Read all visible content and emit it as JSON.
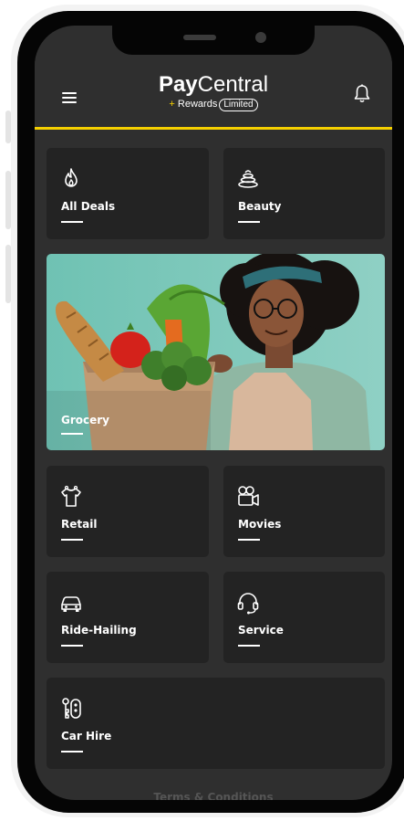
{
  "header": {
    "logo_pay": "Pay",
    "logo_central": "Central",
    "logo_plus": "+",
    "logo_rewards": "Rewards",
    "logo_limited": "Limited",
    "menu_icon": "hamburger-menu-icon",
    "bell_icon": "bell-icon",
    "accent_color": "#f5d000"
  },
  "categories": {
    "all_deals": {
      "label": "All Deals",
      "icon": "fire-icon"
    },
    "beauty": {
      "label": "Beauty",
      "icon": "spa-stones-icon"
    },
    "grocery": {
      "label": "Grocery"
    },
    "retail": {
      "label": "Retail",
      "icon": "shirt-icon"
    },
    "movies": {
      "label": "Movies",
      "icon": "video-camera-icon"
    },
    "ride_hailing": {
      "label": "Ride-Hailing",
      "icon": "car-icon"
    },
    "service": {
      "label": "Service",
      "icon": "headset-icon"
    },
    "car_hire": {
      "label": "Car Hire",
      "icon": "car-keys-icon"
    }
  },
  "footer": {
    "terms": "Terms & Conditions"
  },
  "colors": {
    "background": "#2f2f2f",
    "tile": "#232323",
    "text": "#ffffff"
  }
}
